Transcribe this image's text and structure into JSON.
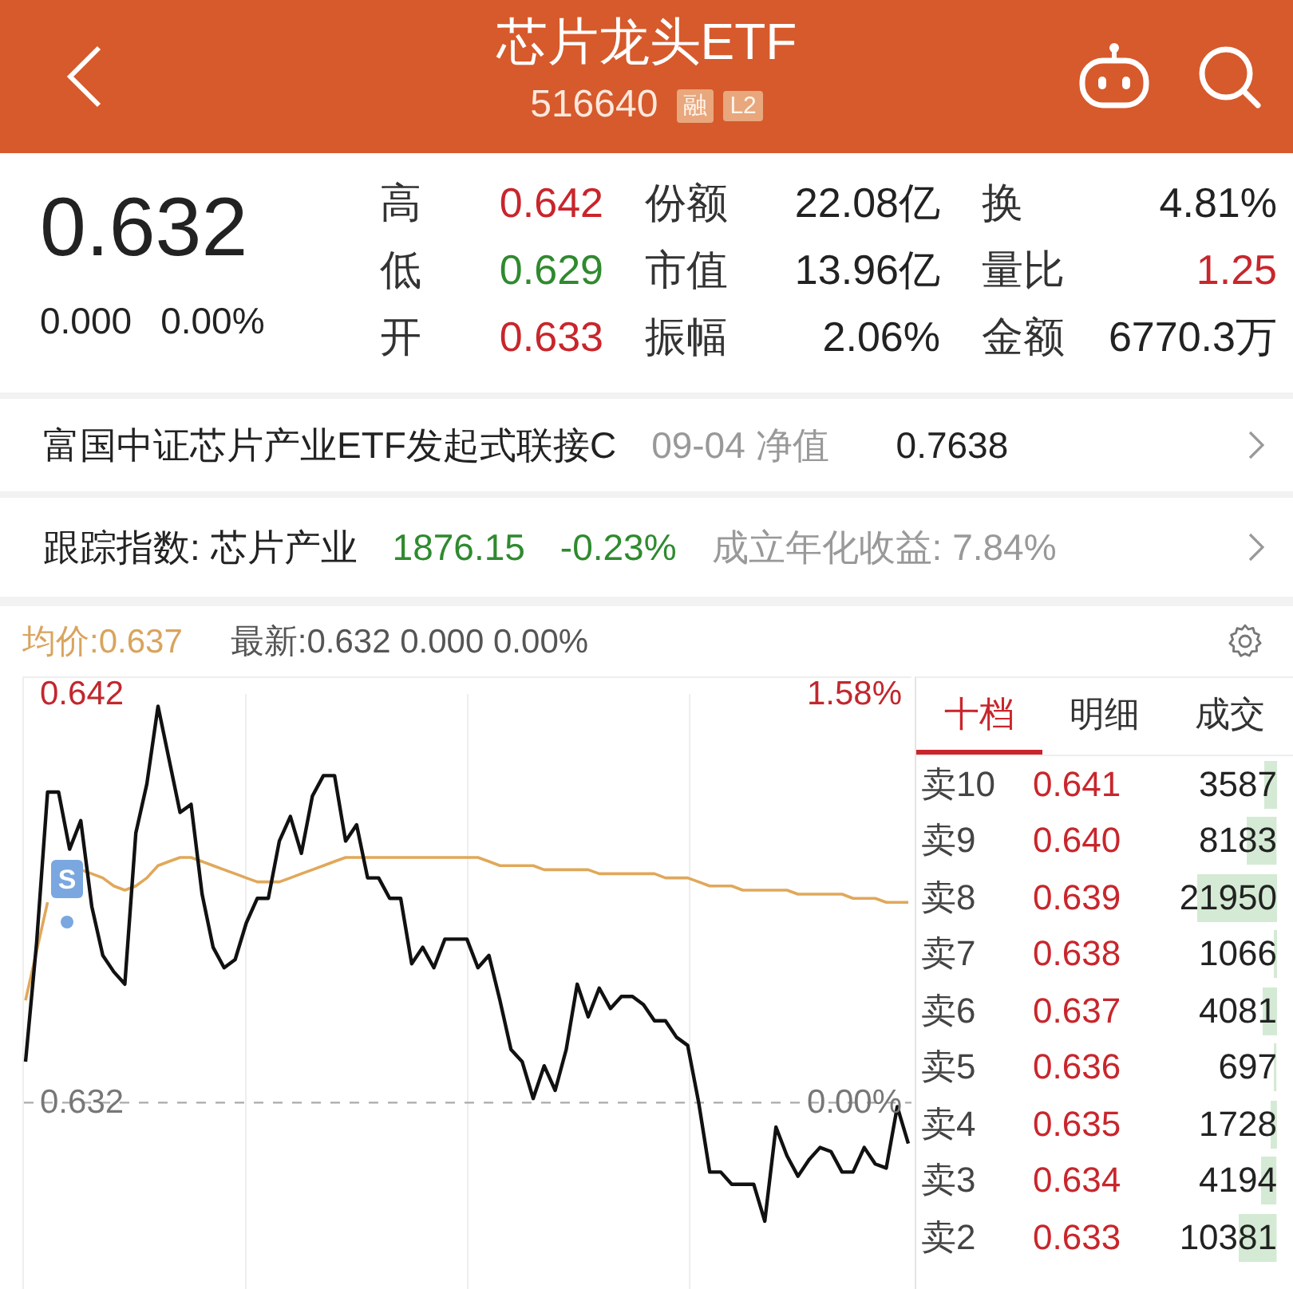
{
  "header": {
    "title": "芯片龙头ETF",
    "code": "516640",
    "badges": [
      {
        "text": "融"
      },
      {
        "text": "L2"
      }
    ]
  },
  "quote": {
    "price": "0.632",
    "change": "0.000",
    "change_pct": "0.00%",
    "stats": [
      {
        "label": "高",
        "value": "0.642",
        "color": "#c8262c"
      },
      {
        "label": "份额",
        "value": "22.08亿",
        "color": "#222222"
      },
      {
        "label": "换",
        "value": "4.81%",
        "color": "#222222"
      },
      {
        "label": "低",
        "value": "0.629",
        "color": "#2f8a2f"
      },
      {
        "label": "市值",
        "value": "13.96亿",
        "color": "#222222"
      },
      {
        "label": "量比",
        "value": "1.25",
        "color": "#c8262c"
      },
      {
        "label": "开",
        "value": "0.633",
        "color": "#c8262c"
      },
      {
        "label": "振幅",
        "value": "2.06%",
        "color": "#222222"
      },
      {
        "label": "金额",
        "value": "6770.3万",
        "color": "#222222"
      }
    ]
  },
  "links": [
    {
      "kind": "fund",
      "name": "富国中证芯片产业ETF发起式联接C",
      "date_label": "09-04 净值",
      "value": "0.7638"
    },
    {
      "kind": "index",
      "name": "跟踪指数: 芯片产业",
      "value": "1876.15",
      "change": "-0.23%",
      "color": "#2f8a2f",
      "note": "成立年化收益: 7.84%"
    }
  ],
  "chart": {
    "average_label": "均价:0.637",
    "latest_label": "最新:0.632 0.000 0.00%",
    "right_ticks": [
      "1.58%",
      "0.00%"
    ],
    "marker": {
      "text": "S"
    },
    "chart_data": {
      "type": "line",
      "categories": [
        null,
        null,
        null,
        null,
        null,
        null,
        null,
        null,
        null,
        null,
        null,
        null,
        null,
        null,
        null,
        null,
        null,
        null,
        null,
        null,
        null,
        null,
        null,
        null,
        null,
        null,
        null,
        null,
        null,
        null,
        null,
        null,
        null,
        null,
        null,
        null,
        null,
        null,
        null,
        null,
        null,
        null,
        null,
        null,
        null,
        null,
        null,
        null,
        null,
        null,
        null,
        null,
        null,
        null,
        null,
        null,
        null,
        null,
        null,
        null,
        null,
        null,
        null,
        null,
        null,
        null,
        null,
        null,
        null,
        null,
        null,
        null,
        null,
        null,
        null,
        null,
        null,
        null,
        null,
        null,
        null
      ],
      "ylim": [
        0.6274,
        0.642
      ],
      "yticks": [
        {
          "value": 0.642,
          "label": "0.642"
        },
        {
          "value": 0.632,
          "label": "0.632"
        }
      ],
      "ref_lines": [
        {
          "axis": "y",
          "value": 0.632
        }
      ],
      "series": [
        {
          "color": "#111111",
          "values": [
            0.633,
            0.6359,
            0.6396,
            0.6396,
            0.6382,
            0.6389,
            0.6368,
            0.6356,
            0.6352,
            0.6349,
            0.6386,
            0.6398,
            0.6417,
            0.6404,
            0.6391,
            0.6393,
            0.6371,
            0.6358,
            0.6353,
            0.6355,
            0.6364,
            0.637,
            0.637,
            0.6384,
            0.639,
            0.6381,
            0.6395,
            0.64,
            0.64,
            0.6384,
            0.6388,
            0.6375,
            0.6375,
            0.637,
            0.637,
            0.6354,
            0.6358,
            0.6353,
            0.636,
            0.636,
            0.636,
            0.6353,
            0.6356,
            0.6345,
            0.6333,
            0.633,
            0.6321,
            0.6329,
            0.6323,
            0.6333,
            0.6349,
            0.6341,
            0.6348,
            0.6343,
            0.6346,
            0.6346,
            0.6344,
            0.634,
            0.634,
            0.6336,
            0.6334,
            0.632,
            0.6303,
            0.6303,
            0.63,
            0.63,
            0.63,
            0.6291,
            0.6314,
            0.6307,
            0.6302,
            0.6306,
            0.6309,
            0.6308,
            0.6303,
            0.6303,
            0.6309,
            0.6305,
            0.6304,
            0.6319,
            0.631
          ]
        },
        {
          "color": "#e0a85a",
          "values": [
            0.6345,
            0.6357,
            0.6369,
            null,
            0.6375,
            0.6377,
            0.6376,
            0.6375,
            0.6373,
            0.6372,
            0.6373,
            0.6375,
            0.6378,
            0.6379,
            0.638,
            0.638,
            0.6379,
            0.6378,
            0.6377,
            0.6376,
            0.6375,
            0.6374,
            0.6374,
            0.6374,
            0.6375,
            0.6376,
            0.6377,
            0.6378,
            0.6379,
            0.638,
            0.638,
            0.638,
            0.638,
            0.638,
            0.638,
            0.638,
            0.638,
            0.638,
            0.638,
            0.638,
            0.638,
            0.638,
            0.6379,
            0.6378,
            0.6378,
            0.6378,
            0.6378,
            0.6377,
            0.6377,
            0.6377,
            0.6377,
            0.6377,
            0.6376,
            0.6376,
            0.6376,
            0.6376,
            0.6376,
            0.6376,
            0.6375,
            0.6375,
            0.6375,
            0.6374,
            0.6373,
            0.6373,
            0.6373,
            0.6372,
            0.6372,
            0.6372,
            0.6372,
            0.6372,
            0.6371,
            0.6371,
            0.6371,
            0.6371,
            0.6371,
            0.637,
            0.637,
            0.637,
            0.6369,
            0.6369,
            0.6369
          ]
        }
      ]
    }
  },
  "order_book": {
    "tabs": [
      {
        "label": "十档",
        "selected": true
      },
      {
        "label": "明细",
        "selected": false
      },
      {
        "label": "成交",
        "selected": false
      }
    ],
    "rows": [
      {
        "label": "卖10",
        "price": "0.641",
        "volume": "3587"
      },
      {
        "label": "卖9",
        "price": "0.640",
        "volume": "8183"
      },
      {
        "label": "卖8",
        "price": "0.639",
        "volume": "21950"
      },
      {
        "label": "卖7",
        "price": "0.638",
        "volume": "1066"
      },
      {
        "label": "卖6",
        "price": "0.637",
        "volume": "4081"
      },
      {
        "label": "卖5",
        "price": "0.636",
        "volume": "697"
      },
      {
        "label": "卖4",
        "price": "0.635",
        "volume": "1728"
      },
      {
        "label": "卖3",
        "price": "0.634",
        "volume": "4194"
      },
      {
        "label": "卖2",
        "price": "0.633",
        "volume": "10381"
      }
    ]
  }
}
